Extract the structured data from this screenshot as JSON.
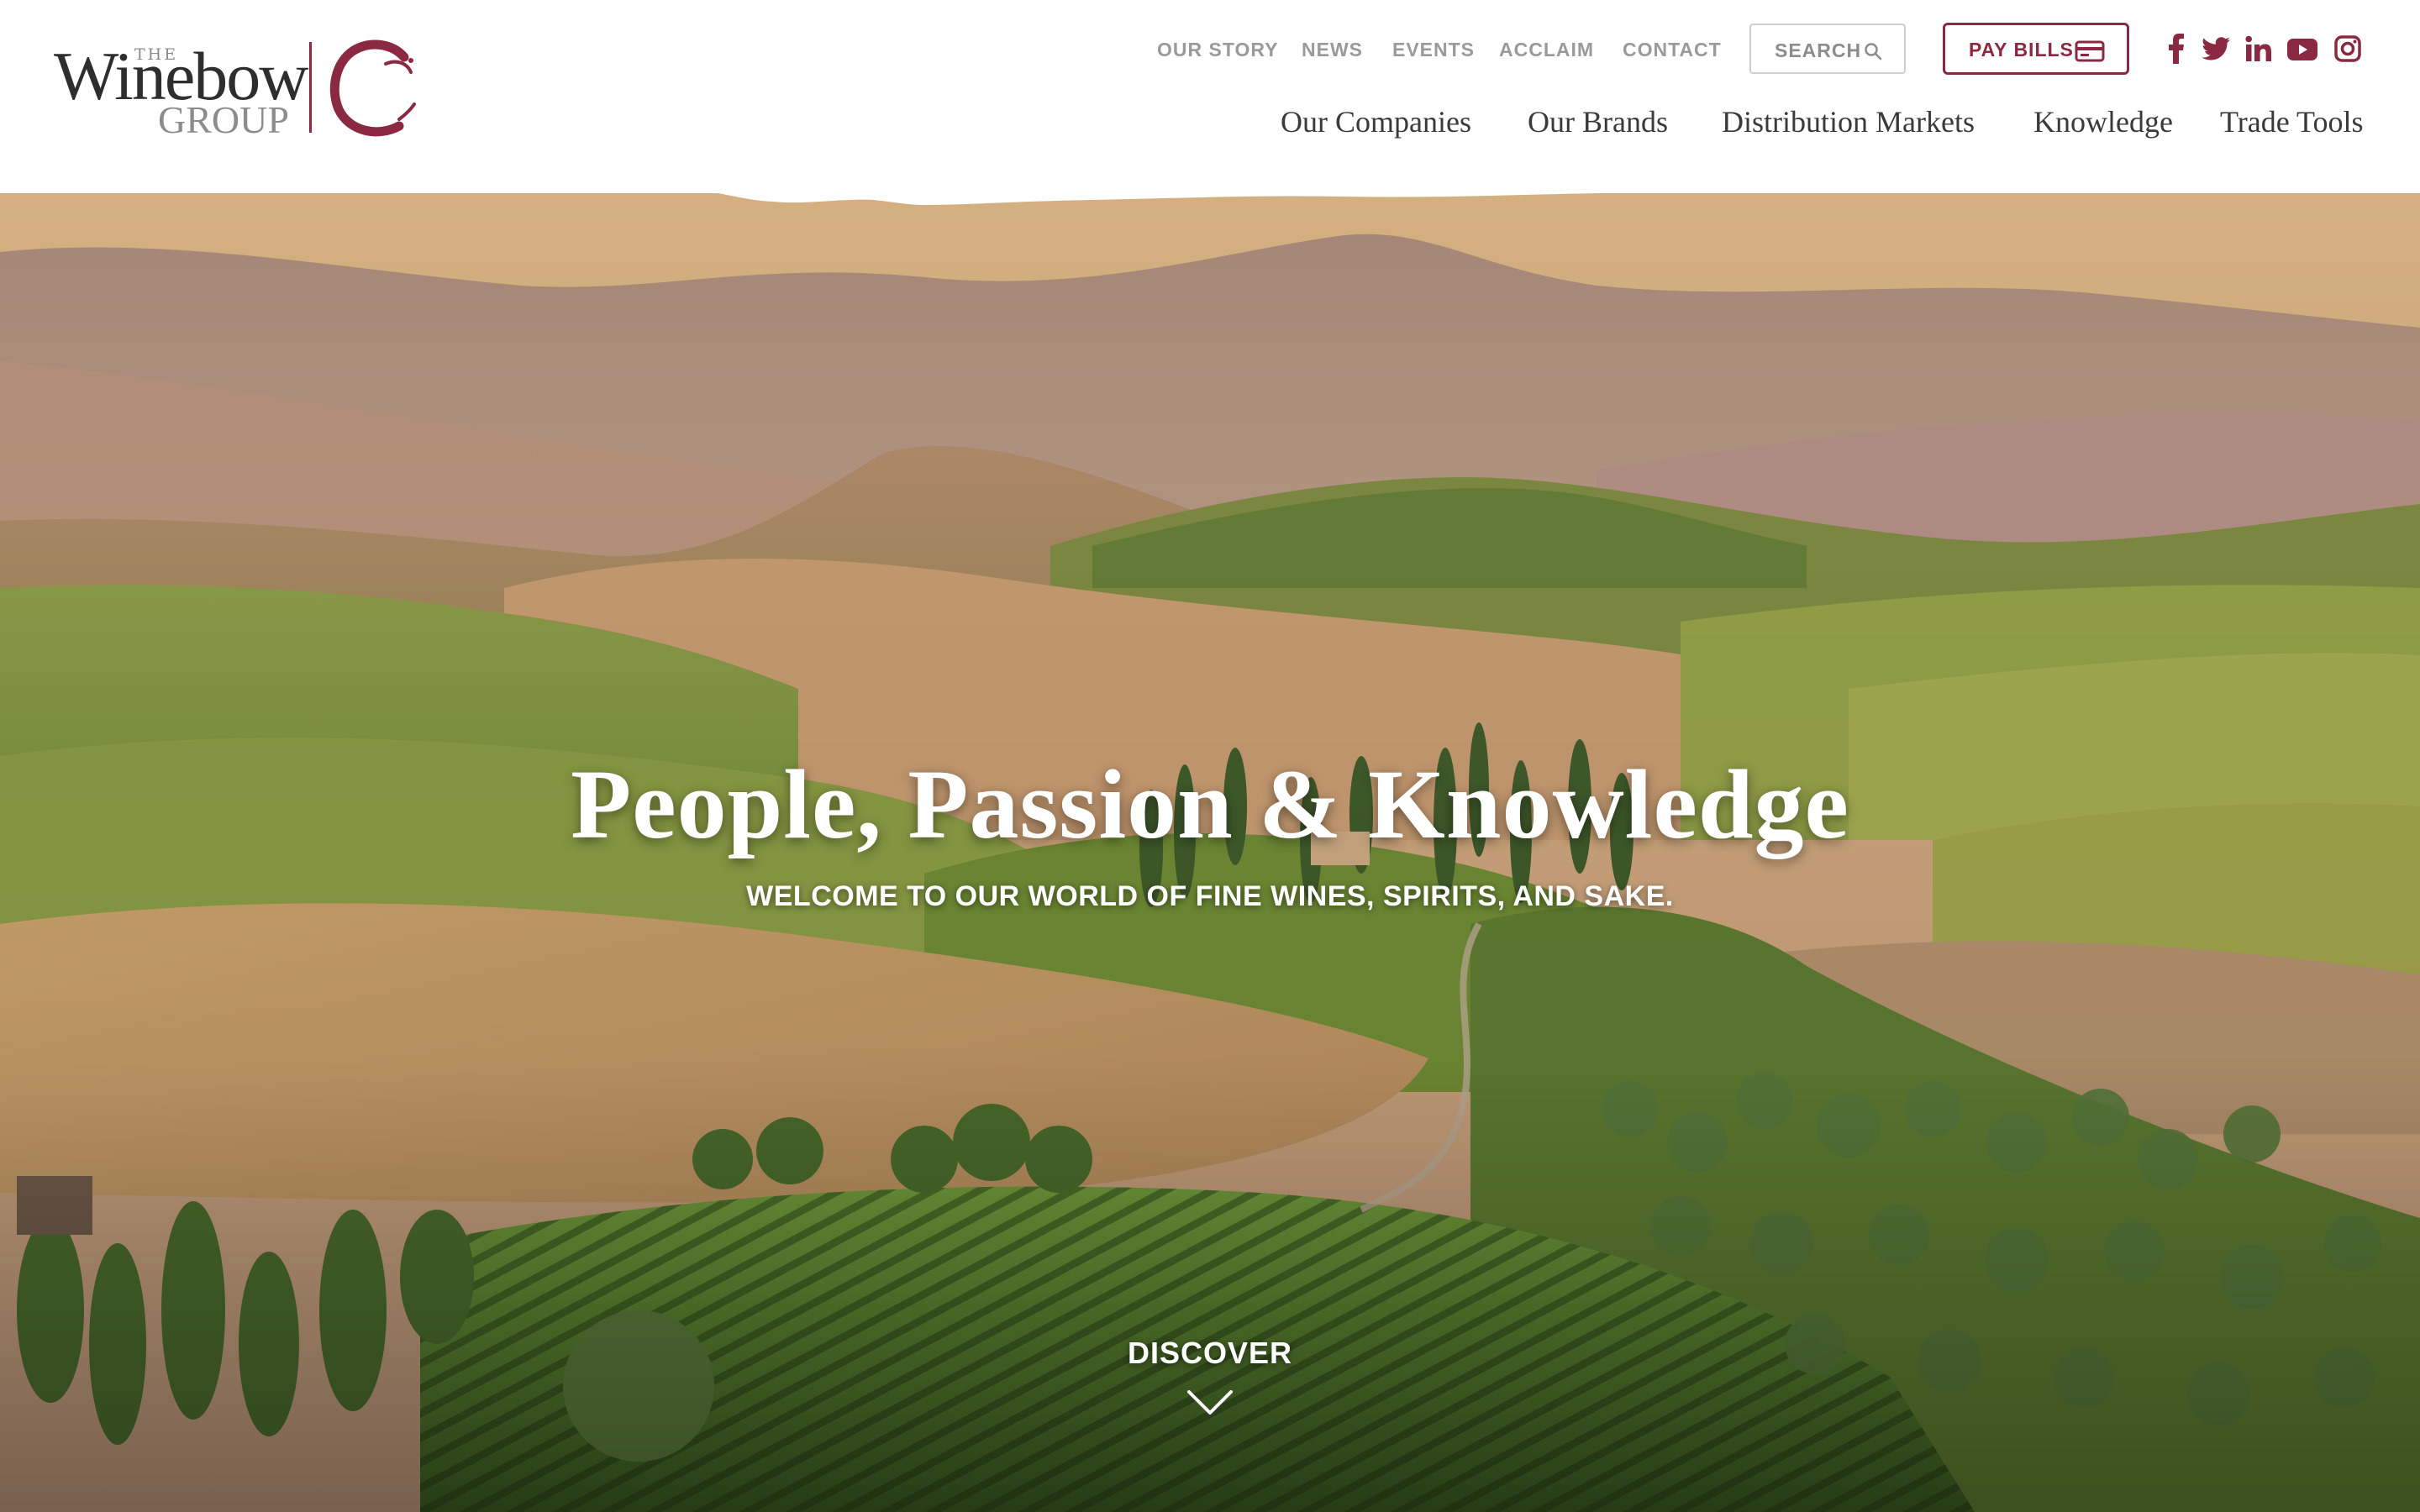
{
  "brand": {
    "logo_the": "THE",
    "logo_name": "Winebow",
    "logo_group": "GROUP",
    "accent_color": "#8b2942"
  },
  "utility_nav": {
    "links": [
      "OUR STORY",
      "NEWS",
      "EVENTS",
      "ACCLAIM",
      "CONTACT"
    ],
    "search_label": "SEARCH",
    "search_icon": "search-icon",
    "pay_bills_label": "PAY BILLS",
    "pay_bills_icon": "credit-card-icon",
    "social_icons": [
      "facebook-icon",
      "twitter-icon",
      "linkedin-icon",
      "youtube-icon",
      "instagram-icon"
    ]
  },
  "main_nav": {
    "links": [
      "Our Companies",
      "Our Brands",
      "Distribution Markets",
      "Knowledge",
      "Trade Tools"
    ]
  },
  "hero": {
    "title": "People, Passion & Knowledge",
    "subtitle": "WELCOME TO OUR WORLD OF FINE WINES, SPIRITS, AND SAKE.",
    "cta_label": "DISCOVER",
    "cta_icon": "chevron-down-icon"
  }
}
